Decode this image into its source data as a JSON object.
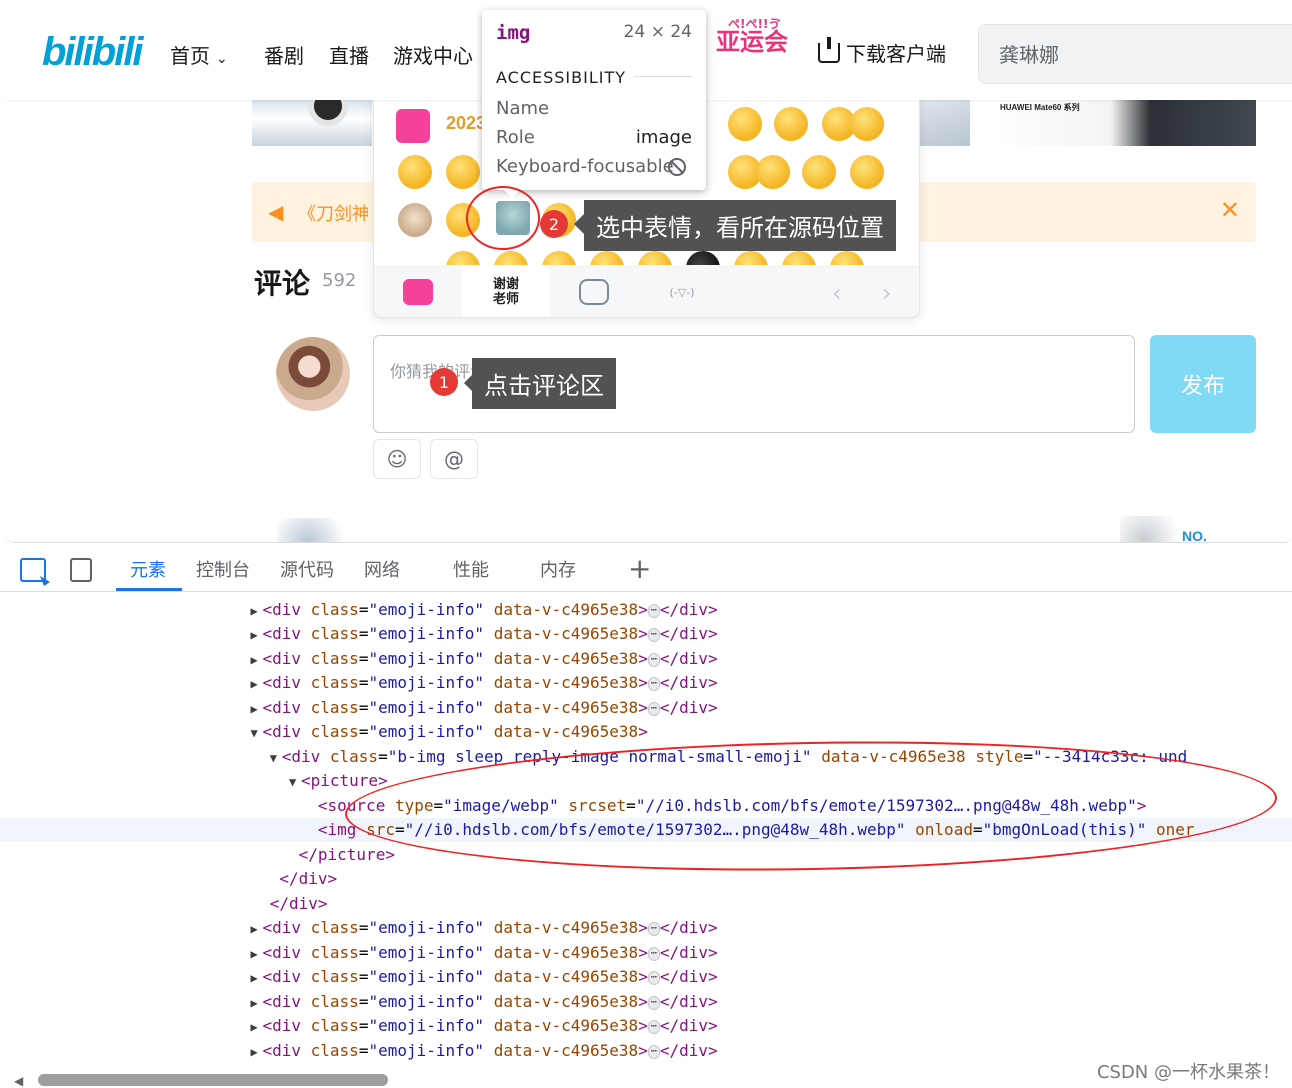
{
  "page": {
    "logo": "bilibili",
    "nav": [
      {
        "label": "首页"
      },
      {
        "label": "番剧"
      },
      {
        "label": "直播"
      },
      {
        "label": "游戏中心"
      }
    ],
    "asiad_small": "ぺ!ぺ!!ゔ",
    "asiad": "亚运会",
    "download": "下载客户端",
    "search_value": "龚琳娜",
    "banner_brand": "HUAWEI Mate60 系列",
    "notice_text": "《刀剑神",
    "comments_title": "评论",
    "comments_count": "592",
    "textarea_placeholder": "你猜我的评论区在等待谁?",
    "publish": "发布",
    "at_symbol": "@",
    "peek_right": "NO."
  },
  "emoji_panel": {
    "tab_2023": "2023",
    "tab_text": "谢谢老师",
    "kaomoji": "(-▽-)",
    "prev": "‹",
    "next": "›"
  },
  "inspector": {
    "tag": "img",
    "size": "24 × 24",
    "section": "ACCESSIBILITY",
    "rows": [
      {
        "key": "Name",
        "value": ""
      },
      {
        "key": "Role",
        "value": "image"
      },
      {
        "key": "Keyboard-focusable",
        "value": ""
      }
    ]
  },
  "annotations": {
    "step1_num": "1",
    "step1_text": "点击评论区",
    "step2_num": "2",
    "step2_text": "选中表情，看所在源码位置"
  },
  "devtools": {
    "tabs": [
      "元素",
      "控制台",
      "源代码",
      "网络",
      "性能",
      "内存"
    ],
    "active_tab": "元素",
    "code": {
      "emoji_info": {
        "tag": "div",
        "attr": "class",
        "val": "\"emoji-info\"",
        "scoped": "data-v-c4965e38",
        "close": "</div>"
      },
      "bimg_class": "\"b-img sleep reply-image normal-small-emoji\"",
      "bimg_style": "\"--3414c33c: und",
      "source_type": "\"image/webp\"",
      "source_srcset": "\"//i0.hdslb.com/bfs/emote/1597302….png@48w_48h.webp\"",
      "img_src": "\"//i0.hdslb.com/bfs/emote/1597302….png@48w_48h.webp\"",
      "img_onload": "\"bmgOnLoad(this)\"",
      "img_tail": "oner"
    }
  },
  "watermark": "CSDN @一杯水果茶！"
}
